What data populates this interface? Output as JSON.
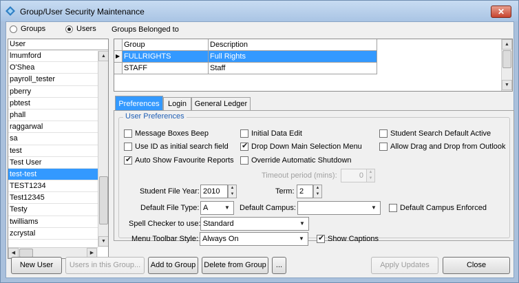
{
  "window": {
    "title": "Group/User Security Maintenance",
    "close_glyph": "✕"
  },
  "mode": {
    "groups_label": "Groups",
    "users_label": "Users",
    "groups_belonged_label": "Groups Belonged to",
    "selected": "Users"
  },
  "users_list": {
    "header": "User",
    "rows": [
      "lmumford",
      "O'Shea",
      "payroll_tester",
      "pberry",
      "pbtest",
      "phall",
      "raggarwal",
      "sa",
      "test",
      "Test User",
      "test-test",
      "TEST1234",
      "Test12345",
      "Testy",
      "twilliams",
      "zcrystal"
    ],
    "selected_index": 10
  },
  "groups_grid": {
    "headers": [
      "Group",
      "Description"
    ],
    "rows": [
      {
        "group": "FULLRIGHTS",
        "description": "Full Rights"
      },
      {
        "group": "STAFF",
        "description": "Staff"
      }
    ],
    "selected_index": 0
  },
  "tabs": [
    {
      "label": "Preferences",
      "active": true
    },
    {
      "label": "Login",
      "active": false
    },
    {
      "label": "General Ledger",
      "active": false
    }
  ],
  "prefs": {
    "legend": "User Preferences",
    "checks": {
      "message_boxes_beep": {
        "label": "Message Boxes Beep",
        "checked": false
      },
      "use_id_search": {
        "label": "Use ID as initial search field",
        "checked": false
      },
      "auto_show_fav": {
        "label": "Auto Show Favourite Reports",
        "checked": true
      },
      "initial_data_edit": {
        "label": "Initial Data Edit",
        "checked": false
      },
      "drop_down_menu": {
        "label": "Drop Down Main Selection Menu",
        "checked": true
      },
      "override_shutdown": {
        "label": "Override Automatic Shutdown",
        "checked": false
      },
      "student_search_active": {
        "label": "Student Search Default Active",
        "checked": false
      },
      "drag_drop_outlook": {
        "label": "Allow Drag and Drop from Outlook",
        "checked": false
      },
      "default_campus_enforced": {
        "label": "Default Campus Enforced",
        "checked": false
      },
      "show_captions": {
        "label": "Show Captions",
        "checked": true
      }
    },
    "timeout_label": "Timeout period (mins):",
    "timeout_value": "0",
    "student_file_year_label": "Student File Year:",
    "student_file_year": "2010",
    "term_label": "Term:",
    "term": "2",
    "default_file_type_label": "Default File Type:",
    "default_file_type": "A",
    "default_campus_label": "Default Campus:",
    "default_campus": "",
    "spell_checker_label": "Spell Checker to use:",
    "spell_checker": "Standard",
    "menu_toolbar_label": "Menu Toolbar Style:",
    "menu_toolbar": "Always On"
  },
  "buttons": {
    "new_user": "New User",
    "users_in_group": "Users in this Group...",
    "add_to_group": "Add to Group",
    "delete_from_group": "Delete from Group",
    "more": "...",
    "apply_updates": "Apply Updates",
    "close": "Close"
  }
}
